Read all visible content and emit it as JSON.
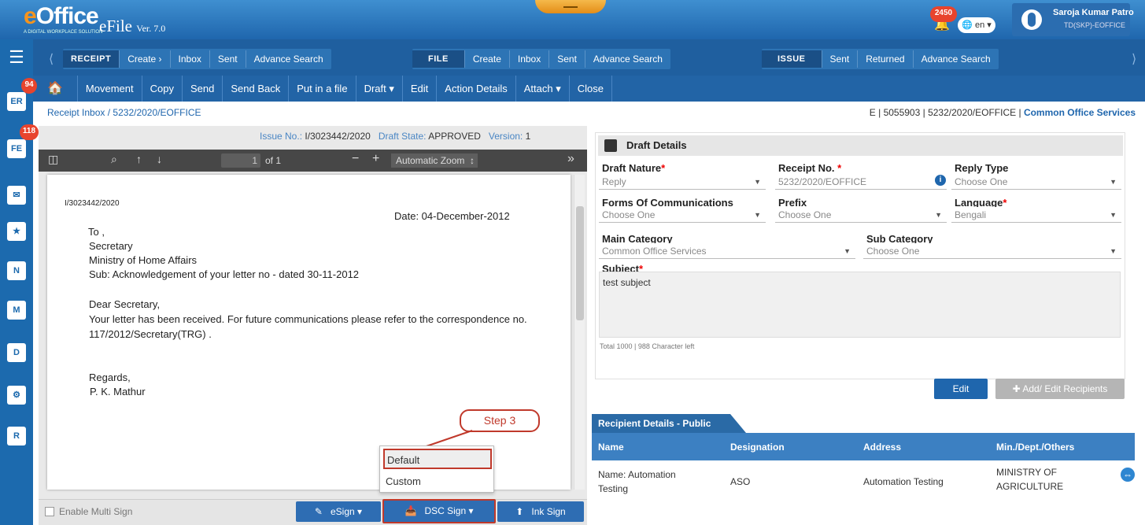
{
  "header": {
    "logo_e": "e",
    "logo_rest": "Office",
    "logo_tagline": "A DIGITAL WORKPLACE SOLUTION",
    "app_name": "eFile",
    "app_version": "Ver. 7.0",
    "notification_count": "2450",
    "language": "en",
    "user_name": "Saroja Kumar Patro",
    "user_designation": "TD(SKP)-EOFFICE"
  },
  "nav": {
    "receipt": [
      "RECEIPT",
      "Create ›",
      "Inbox",
      "Sent",
      "Advance Search"
    ],
    "file": [
      "FILE",
      "Create",
      "Inbox",
      "Sent",
      "Advance Search"
    ],
    "issue": [
      "ISSUE",
      "Sent",
      "Returned",
      "Advance Search"
    ]
  },
  "toolbar": [
    "Movement",
    "Copy",
    "Send",
    "Send Back",
    "Put in a file",
    "Draft ▾",
    "Edit",
    "Action Details",
    "Attach ▾",
    "Close"
  ],
  "sidebar_badges": {
    "er": "94",
    "fe": "118"
  },
  "breadcrumb": {
    "root": "Receipt Inbox",
    "sep": "/",
    "current": "5232/2020/EOFFICE"
  },
  "right_breadcrumb": {
    "e": "E",
    "num": "5055903",
    "receipt": "5232/2020/EOFFICE",
    "category": "Common Office Services"
  },
  "issue_info": {
    "issue_label": "Issue No.:",
    "issue_no": "I/3023442/2020",
    "state_label": "Draft State:",
    "state": "APPROVED",
    "version_label": "Version:",
    "version": "1"
  },
  "pdf": {
    "page": "1",
    "of": "of 1",
    "zoom": "Automatic Zoom"
  },
  "letter": {
    "ref": "I/3023442/2020",
    "date": "Date: 04-December-2012",
    "to": "To ,",
    "l1": "Secretary",
    "l2": "Ministry of Home Affairs",
    "sub": "Sub: Acknowledgement of your letter no - dated 30-11-2012",
    "greet": "Dear Secretary,",
    "body1": "Your letter has been received. For future communications please refer to the correspondence no.",
    "body2": "117/2012/Secretary(TRG) .",
    "regards": "Regards,",
    "sign": "P. K. Mathur"
  },
  "bottom": {
    "multi_sign": "Enable Multi Sign",
    "esign": "eSign ▾",
    "dsc": "DSC Sign ▾",
    "ink": "Ink Sign"
  },
  "callout": "Step 3",
  "dropdown": [
    "Default",
    "Custom"
  ],
  "draft": {
    "title": "Draft Details",
    "nature_label": "Draft Nature",
    "nature_value": "Reply",
    "receipt_label": "Receipt No.",
    "receipt_value": "5232/2020/EOFFICE",
    "reply_label": "Reply Type",
    "reply_value": "Choose One",
    "forms_label": "Forms Of Communications",
    "forms_value": "Choose One",
    "prefix_label": "Prefix",
    "prefix_value": "Choose One",
    "lang_label": "Language",
    "lang_value": "Bengali",
    "main_label": "Main Category",
    "main_value": "Common Office Services",
    "sub_label": "Sub Category",
    "sub_value": "Choose One",
    "subject_label": "Subject",
    "subject_value": "test subject",
    "char_info": "Total 1000 | 988 Character left",
    "edit": "Edit",
    "add_edit": "Add/ Edit Recipients"
  },
  "recipients": {
    "tab": "Recipient Details - Public",
    "headers": [
      "Name",
      "Designation",
      "Address",
      "Min./Dept./Others"
    ],
    "row": {
      "name1": "Name: Automation",
      "name2": "Testing",
      "designation": "ASO",
      "address": "Automation Testing",
      "min1": "MINISTRY OF",
      "min2": "AGRICULTURE"
    }
  }
}
